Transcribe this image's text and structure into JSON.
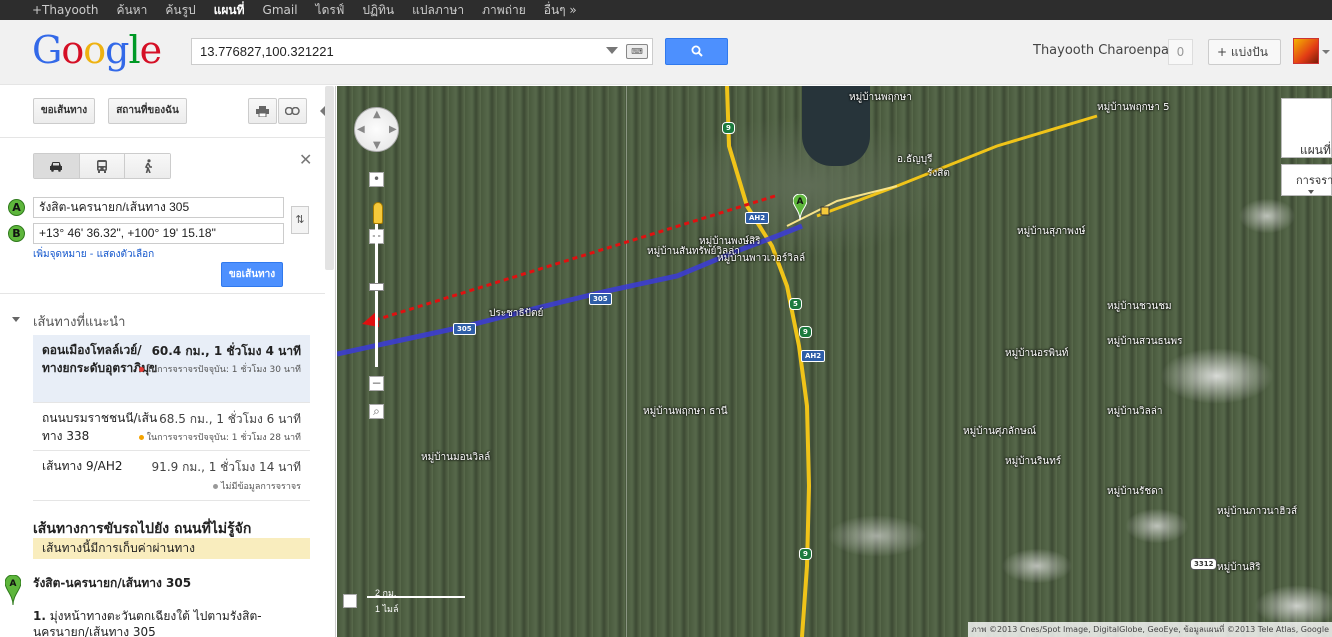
{
  "topnav": {
    "items": [
      "+Thayooth",
      "ค้นหา",
      "ค้นรูป",
      "แผนที่",
      "Gmail",
      "ไดรฟ์",
      "ปฏิทิน",
      "แปลภาษา",
      "ภาพถ่าย",
      "อื่นๆ »"
    ],
    "active_index": 3
  },
  "header": {
    "logo": [
      "G",
      "o",
      "o",
      "g",
      "l",
      "e"
    ],
    "search_value": "13.776827,100.321221",
    "user_name": "Thayooth Charoenpak",
    "notifications": "0",
    "share_label": "+ แบ่งปัน"
  },
  "panel": {
    "get_directions_label": "ขอเส้นทาง",
    "my_places_label": "สถานที่ของฉัน",
    "field_a": "รังสิต-นครนายก/เส้นทาง 305",
    "field_b": "+13° 46' 36.32\", +100° 19' 15.18\"",
    "marker_a": "A",
    "marker_b": "B",
    "add_destination": "เพิ่มจุดหมาย - แสดงตัวเลือก",
    "submit_label": "ขอเส้นทาง",
    "suggested_title": "เส้นทางที่แนะนำ",
    "routes": [
      {
        "name": "ดอนเมืองโทลล์เวย์/ทางยกระดับอุตราภิมุข",
        "dist": "60.4 กม., 1 ชั่วโมง 4 นาที",
        "traffic": "ในการจราจรปัจจุบัน: 1 ชั่วโมง 30 นาที",
        "dot": "#e53935"
      },
      {
        "name": "ถนนบรมราชชนนี/เส้นทาง 338",
        "dist": "68.5 กม., 1 ชั่วโมง 6 นาที",
        "traffic": "ในการจราจรปัจจุบัน: 1 ชั่วโมง 28 นาที",
        "dot": "#f4a300"
      },
      {
        "name": "เส้นทาง 9/AH2",
        "dist": "91.9 กม., 1 ชั่วโมง 14 นาที",
        "traffic": "ไม่มีข้อมูลการจราจร",
        "dot": "#999999"
      }
    ],
    "directions_title": "เส้นทางการขับรถไปยัง ถนนที่ไม่รู้จัก",
    "toll_note": "เส้นทางนี้มีการเก็บค่าผ่านทาง",
    "start_label": "รังสิต-นครนายก/เส้นทาง 305",
    "step1_num": "1.",
    "step1_text": "มุ่งหน้าทางตะวันตกเฉียงใต้ ไปตามรังสิต-นครนายก/เส้นทาง 305"
  },
  "map": {
    "scale_km": "2 กม.",
    "scale_mi": "1 ไมล์",
    "copyright": "ภาพ ©2013 Cnes/Spot Image, DigitalGlobe, GeoEye, ข้อมูลแผนที่ ©2013 Tele Atlas, Google",
    "map_type": "แผนที่",
    "traffic_type": "การจรา",
    "labels": [
      "หมู่บ้านพฤกษา",
      "หมู่บ้านพฤกษา 5",
      "อ.ธัญบุรี",
      "รังสิต",
      "หมู่บ้านสุภาพงษ์",
      "หมู่บ้านสันทรัพย์วิลล่า",
      "ประชาธิปัตย์",
      "หมู่บ้านอรพินท์",
      "หมู่บ้านชวนชม",
      "หมู่บ้านสวนธนพร",
      "หมู่บ้านศุภลักษณ์",
      "หมู่บ้านรินทร์",
      "หมู่บ้านมอนวิลล์",
      "หมู่บ้านพฤกษา ธานี",
      "หมู่บ้านพงษ์สิริ",
      "หมู่บ้านพาวเวอร์วิลล์",
      "หมู่บ้านภาวนาฮิวส์",
      "หมู่บ้านรัชดา",
      "หมู่บ้านวิลล่า",
      "หมู่บ้านสิริ"
    ],
    "shields": [
      "9",
      "AH2",
      "305",
      "305",
      "9",
      "AH2",
      "9",
      "3312",
      "5"
    ],
    "pin_label": "A",
    "colors": {
      "route_main": "#3b3bd8",
      "route_alt": "#e01010",
      "highway": "#f0c419"
    }
  }
}
